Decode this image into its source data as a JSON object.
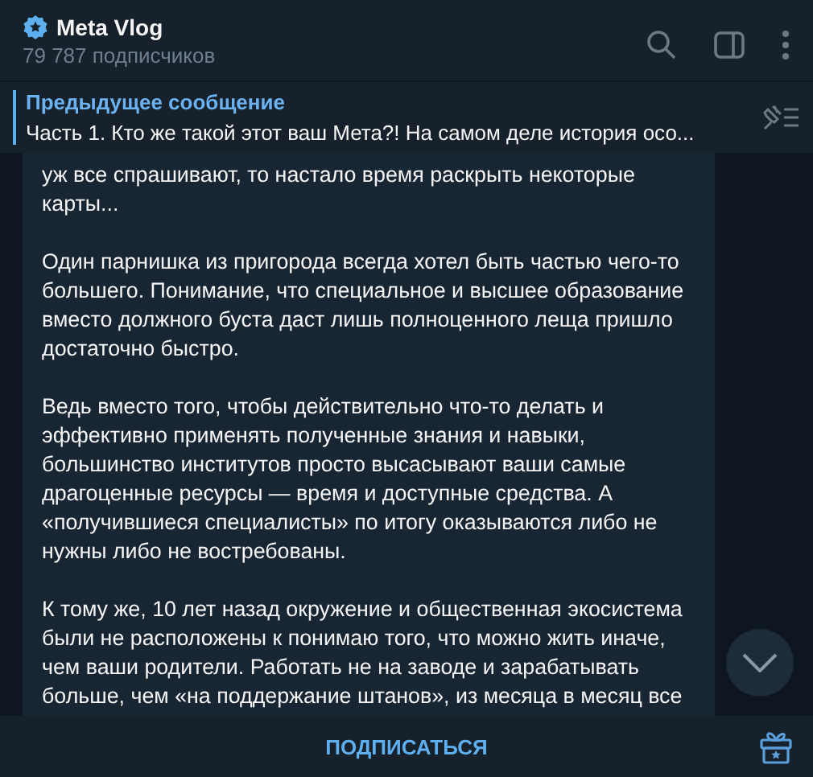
{
  "header": {
    "title": "Meta Vlog",
    "subtitle": "79 787 подписчиков",
    "verified": true
  },
  "pinned": {
    "title": "Предыдущее сообщение",
    "text": "Часть 1.  Кто же такой этот ваш Мета?!  На самом деле история осо..."
  },
  "message": {
    "paragraphs": [
      "уж все спрашивают, то настало время раскрыть некоторые карты...",
      "Один парнишка из пригорода всегда хотел быть частью чего-то большего. Понимание, что специальное и высшее образование вместо должного буста даст лишь полноценного леща пришло достаточно быстро.",
      "Ведь вместо того, чтобы действительно что-то делать и эффективно применять полученные знания и навыки, большинство институтов просто высасывают ваши самые драгоценные ресурсы — время и доступные средства. А «получившиеся специалисты» по итогу оказываются либо не нужны либо не востребованы.",
      "К тому же, 10 лет назад окружение и общественная экосистема были не расположены к понимаю того, что можно жить иначе, чем ваши родители. Работать не на заводе и зарабатывать больше, чем «на поддержание штанов», из месяца в месяц все"
    ]
  },
  "footer": {
    "button": "ПОДПИСАТЬСЯ"
  }
}
